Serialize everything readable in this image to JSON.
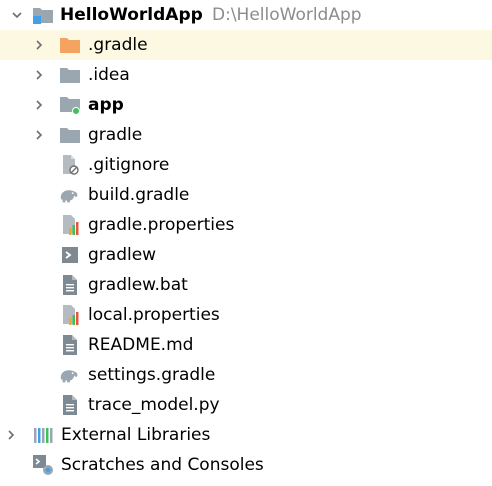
{
  "project": {
    "name": "HelloWorldApp",
    "path": "D:\\HelloWorldApp"
  },
  "items": [
    {
      "label": ".gradle"
    },
    {
      "label": ".idea"
    },
    {
      "label": "app"
    },
    {
      "label": "gradle"
    },
    {
      "label": ".gitignore"
    },
    {
      "label": "build.gradle"
    },
    {
      "label": "gradle.properties"
    },
    {
      "label": "gradlew"
    },
    {
      "label": "gradlew.bat"
    },
    {
      "label": "local.properties"
    },
    {
      "label": "README.md"
    },
    {
      "label": "settings.gradle"
    },
    {
      "label": "trace_model.py"
    }
  ],
  "external_libraries": {
    "label": "External Libraries"
  },
  "scratches": {
    "label": "Scratches and Consoles"
  },
  "colors": {
    "selected_row": "#fdf8e2",
    "folder_gray": "#9aa7b0",
    "folder_orange": "#f4a460",
    "module_dot": "#3dc05a",
    "path_text": "#8c8c8c"
  }
}
